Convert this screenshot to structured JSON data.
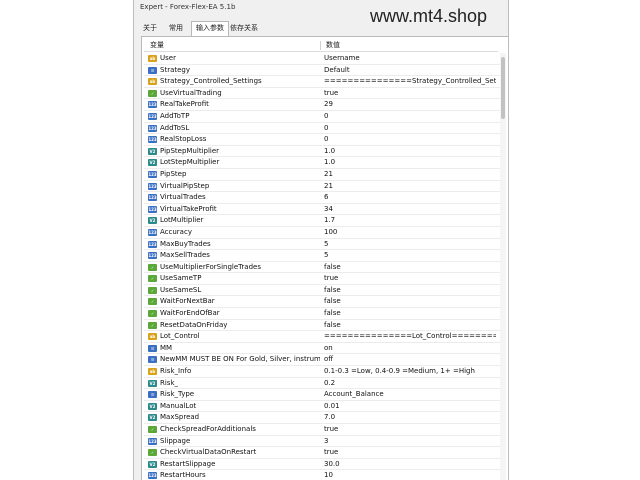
{
  "window": {
    "title": "Expert - Forex-Flex-EA 5.1b"
  },
  "watermark": "www.mt4.shop",
  "tabs": [
    {
      "label": "关于"
    },
    {
      "label": "常用"
    },
    {
      "label": "输入参数"
    },
    {
      "label": "依存关系"
    }
  ],
  "table": {
    "headers": {
      "variable": "变量",
      "value": "数值"
    },
    "rows": [
      {
        "name": "User",
        "value": "Username",
        "type": "str"
      },
      {
        "name": "Strategy",
        "value": "Default",
        "type": "enum"
      },
      {
        "name": "Strategy_Controlled_Settings",
        "value": "===============Strategy_Controlled_Settings...",
        "type": "str"
      },
      {
        "name": "UseVirtualTrading",
        "value": "true",
        "type": "bool"
      },
      {
        "name": "RealTakeProfit",
        "value": "29",
        "type": "int"
      },
      {
        "name": "AddToTP",
        "value": "0",
        "type": "int"
      },
      {
        "name": "AddToSL",
        "value": "0",
        "type": "int"
      },
      {
        "name": "RealStopLoss",
        "value": "0",
        "type": "int"
      },
      {
        "name": "PipStepMultiplier",
        "value": "1.0",
        "type": "dbl"
      },
      {
        "name": "LotStepMultiplier",
        "value": "1.0",
        "type": "dbl"
      },
      {
        "name": "PipStep",
        "value": "21",
        "type": "int"
      },
      {
        "name": "VirtualPipStep",
        "value": "21",
        "type": "int"
      },
      {
        "name": "VirtualTrades",
        "value": "6",
        "type": "int"
      },
      {
        "name": "VirtualTakeProfit",
        "value": "34",
        "type": "int"
      },
      {
        "name": "LotMultiplier",
        "value": "1.7",
        "type": "dbl"
      },
      {
        "name": "Accuracy",
        "value": "100",
        "type": "int"
      },
      {
        "name": "MaxBuyTrades",
        "value": "5",
        "type": "int"
      },
      {
        "name": "MaxSellTrades",
        "value": "5",
        "type": "int"
      },
      {
        "name": "UseMultiplierForSingleTrades",
        "value": "false",
        "type": "bool"
      },
      {
        "name": "UseSameTP",
        "value": "true",
        "type": "bool"
      },
      {
        "name": "UseSameSL",
        "value": "false",
        "type": "bool"
      },
      {
        "name": "WaitForNextBar",
        "value": "false",
        "type": "bool"
      },
      {
        "name": "WaitForEndOfBar",
        "value": "false",
        "type": "bool"
      },
      {
        "name": "ResetDataOnFriday",
        "value": "false",
        "type": "bool"
      },
      {
        "name": "Lot_Control",
        "value": "===============Lot_Control=========...",
        "type": "str"
      },
      {
        "name": "MM",
        "value": "on",
        "type": "enum"
      },
      {
        "name": "NewMM MUST BE ON For Gold, Silver, instrume...",
        "value": "off",
        "type": "enum"
      },
      {
        "name": "Risk_Info",
        "value": "0.1-0.3 =Low, 0.4-0.9 =Medium, 1+ =High",
        "type": "str"
      },
      {
        "name": "Risk_",
        "value": "0.2",
        "type": "dbl"
      },
      {
        "name": "Risk_Type",
        "value": "Account_Balance",
        "type": "enum"
      },
      {
        "name": "ManualLot",
        "value": "0.01",
        "type": "dbl"
      },
      {
        "name": "MaxSpread",
        "value": "7.0",
        "type": "dbl"
      },
      {
        "name": "CheckSpreadForAdditionals",
        "value": "true",
        "type": "bool"
      },
      {
        "name": "Slippage",
        "value": "3",
        "type": "int"
      },
      {
        "name": "CheckVirtualDataOnRestart",
        "value": "true",
        "type": "bool"
      },
      {
        "name": "RestartSlippage",
        "value": "30.0",
        "type": "dbl"
      },
      {
        "name": "RestartHours",
        "value": "10",
        "type": "int"
      }
    ]
  },
  "colors": {
    "int": "#3a6fc4",
    "double": "#2d8a8a",
    "string": "#d9a21b",
    "bool": "#5aa83a"
  },
  "type_badges": {
    "int": "123",
    "dbl": "V2",
    "str": "ab",
    "bool": "✓",
    "enum": "☰"
  }
}
